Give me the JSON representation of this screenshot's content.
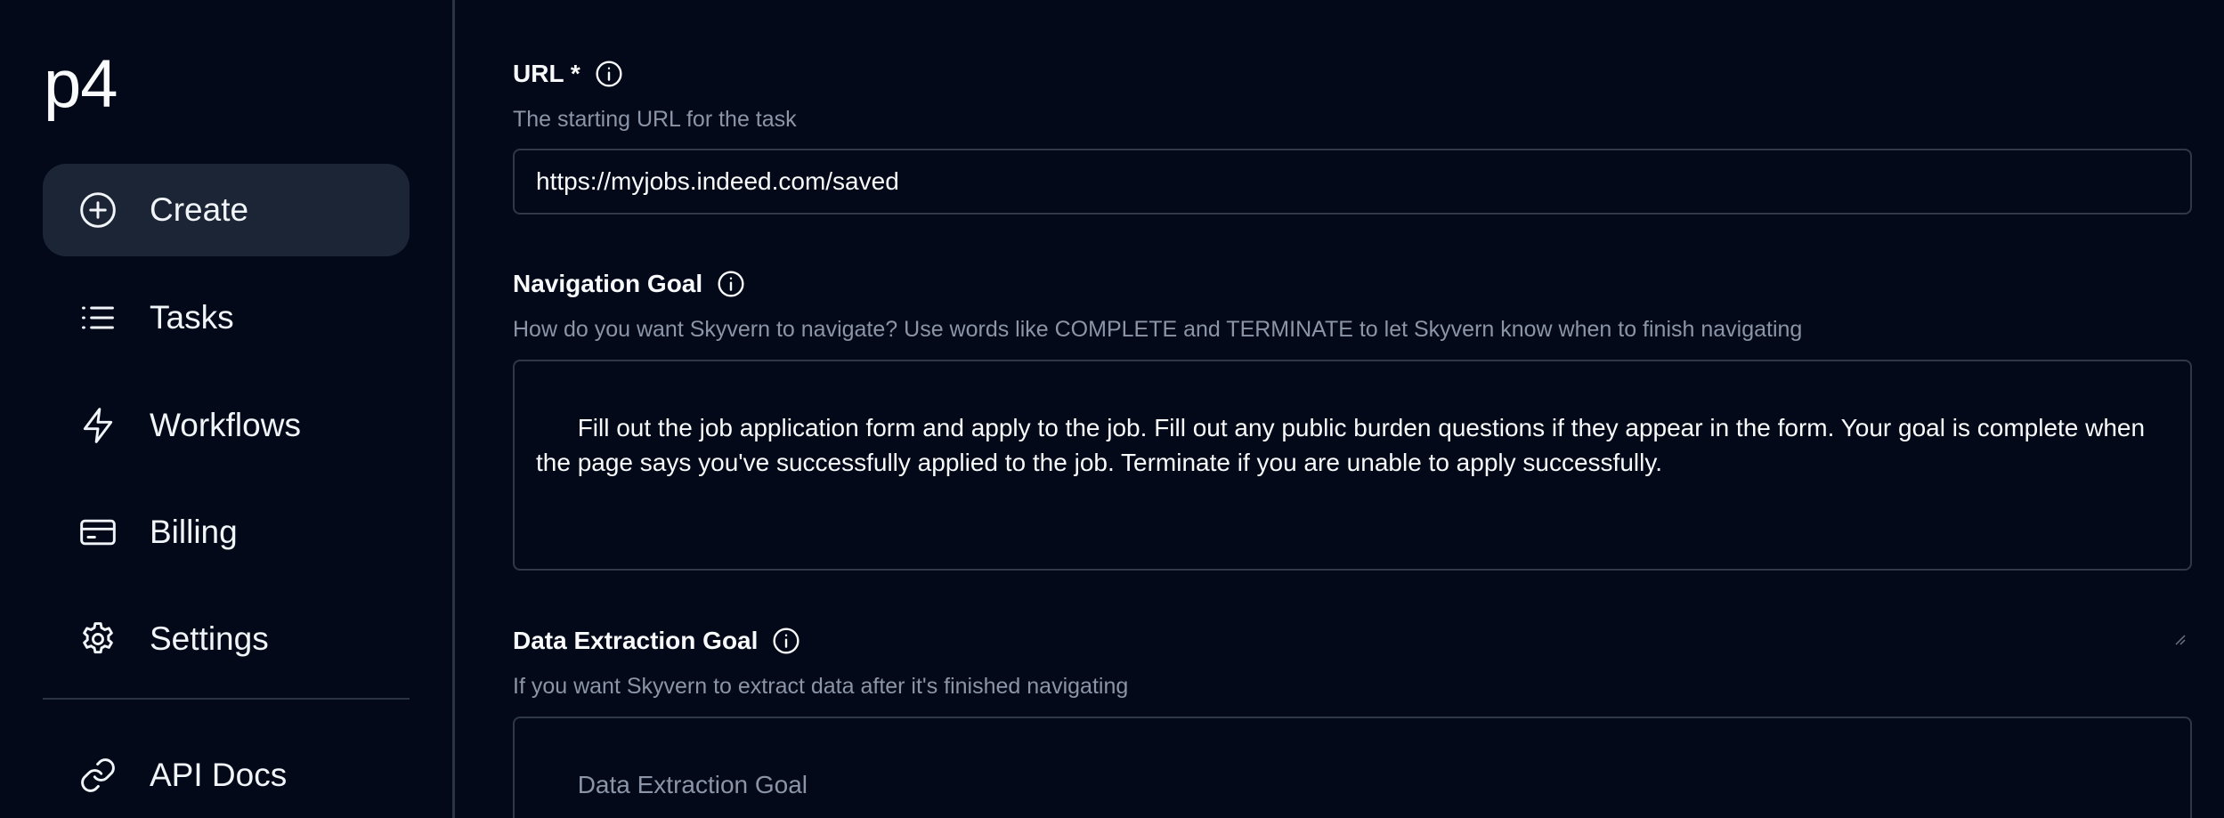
{
  "sidebar": {
    "logo": "p4",
    "items": [
      {
        "label": "Create",
        "icon": "plus-circle-icon"
      },
      {
        "label": "Tasks",
        "icon": "list-icon"
      },
      {
        "label": "Workflows",
        "icon": "lightning-icon"
      },
      {
        "label": "Billing",
        "icon": "credit-card-icon"
      },
      {
        "label": "Settings",
        "icon": "gear-icon"
      }
    ],
    "footer_items": [
      {
        "label": "API Docs",
        "icon": "link-icon"
      }
    ]
  },
  "form": {
    "url": {
      "title": "URL *",
      "description": "The starting URL for the task",
      "value": "https://myjobs.indeed.com/saved"
    },
    "navigation_goal": {
      "title": "Navigation Goal",
      "description": "How do you want Skyvern to navigate? Use words like COMPLETE and TERMINATE to let Skyvern know when to finish navigating",
      "value": "Fill out the job application form and apply to the job. Fill out any public burden questions if they appear in the form. Your goal is complete when the page says you've successfully applied to the job. Terminate if you are unable to apply successfully."
    },
    "data_extraction_goal": {
      "title": "Data Extraction Goal",
      "description": "If you want Skyvern to extract data after it's finished navigating",
      "placeholder": "Data Extraction Goal"
    }
  },
  "colors": {
    "background": "#030918",
    "active_nav": "#1c2535",
    "border": "#2f3847",
    "muted_text": "#8b95a7"
  }
}
